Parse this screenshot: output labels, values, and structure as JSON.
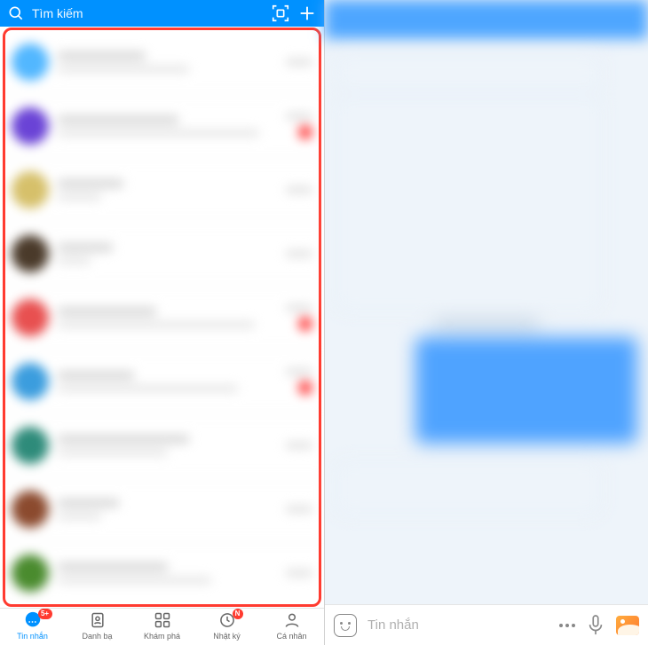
{
  "left": {
    "search_placeholder": "Tìm kiếm",
    "nav": {
      "messages": {
        "label": "Tin nhắn",
        "badge": "5+"
      },
      "contacts": {
        "label": "Danh bạ"
      },
      "discover": {
        "label": "Khám phá"
      },
      "diary": {
        "label": "Nhật ký",
        "badge": "N"
      },
      "me": {
        "label": "Cá nhân"
      }
    }
  },
  "right": {
    "input_placeholder": "Tin nhắn"
  }
}
